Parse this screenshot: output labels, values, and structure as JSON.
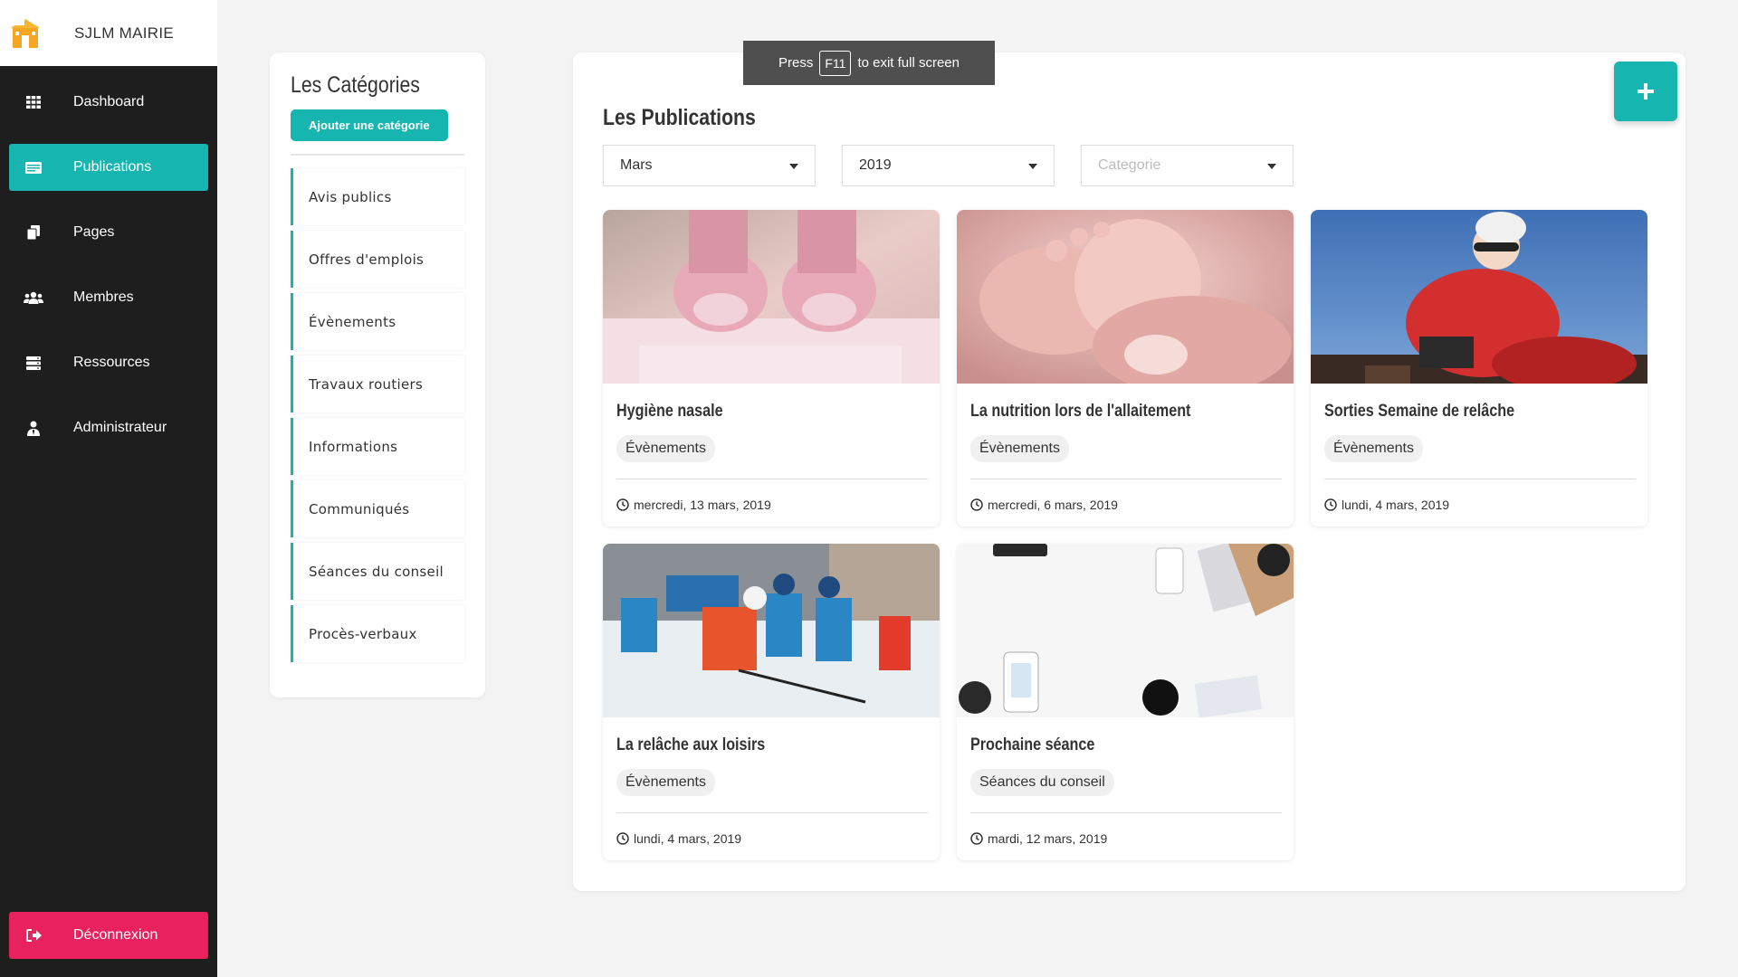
{
  "brand": {
    "name": "SJLM MAIRIE"
  },
  "nav": [
    {
      "label": "Dashboard",
      "icon": "grid-icon",
      "active": false
    },
    {
      "label": "Publications",
      "icon": "newspaper-icon",
      "active": true
    },
    {
      "label": "Pages",
      "icon": "copy-icon",
      "active": false
    },
    {
      "label": "Membres",
      "icon": "users-icon",
      "active": false
    },
    {
      "label": "Ressources",
      "icon": "server-icon",
      "active": false
    },
    {
      "label": "Administrateur",
      "icon": "user-tie-icon",
      "active": false
    }
  ],
  "logout": {
    "label": "Déconnexion",
    "icon": "sign-out-icon"
  },
  "categories": {
    "title": "Les Catégories",
    "add_button": "Ajouter une catégorie",
    "items": [
      "Avis publics",
      "Offres d'emplois",
      "Évènements",
      "Travaux routiers",
      "Informations",
      "Communiqués",
      "Séances du conseil",
      "Procès-verbaux"
    ]
  },
  "publications": {
    "title": "Les Publications",
    "filters": {
      "month": "Mars",
      "year": "2019",
      "category_placeholder": "Categorie"
    },
    "cards": [
      {
        "title": "Hygiène nasale",
        "category": "Évènements",
        "date": "mercredi, 13 mars, 2019",
        "image": "baby-booties-photo"
      },
      {
        "title": "La nutrition lors de l'allaitement",
        "category": "Évènements",
        "date": "mercredi, 6 mars, 2019",
        "image": "baby-feet-photo"
      },
      {
        "title": "Sorties Semaine de relâche",
        "category": "Évènements",
        "date": "lundi, 4 mars, 2019",
        "image": "kids-sled-photo"
      },
      {
        "title": "La relâche aux loisirs",
        "category": "Évènements",
        "date": "lundi, 4 mars, 2019",
        "image": "kids-hockey-photo"
      },
      {
        "title": "Prochaine séance",
        "category": "Séances du conseil",
        "date": "mardi, 12 mars, 2019",
        "image": "desk-photo"
      }
    ]
  },
  "toast": {
    "before": "Press",
    "key": "F11",
    "after": "to exit full screen"
  },
  "colors": {
    "accent": "#17b5b0",
    "danger": "#e8215f",
    "sidebar": "#1e1e1e"
  }
}
